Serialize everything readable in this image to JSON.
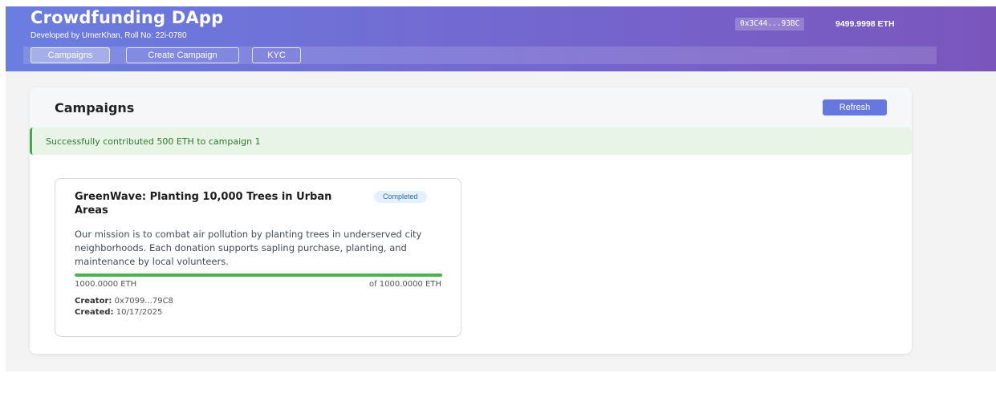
{
  "app": {
    "title": "Crowdfunding DApp",
    "subtitle": "Developed by UmerKhan, Roll No: 22i-0780"
  },
  "nav": {
    "items": [
      {
        "label": "Campaigns",
        "active": true
      },
      {
        "label": "Create Campaign",
        "active": false
      },
      {
        "label": "KYC",
        "active": false
      }
    ]
  },
  "wallet": {
    "address": "0x3C44...93BC",
    "balance": "9499.9998 ETH"
  },
  "panel": {
    "title": "Campaigns",
    "refresh_label": "Refresh"
  },
  "alert": {
    "message": "Successfully contributed 500 ETH to campaign 1"
  },
  "campaign": {
    "title": "GreenWave: Planting 10,000 Trees in Urban Areas",
    "status": "Completed",
    "description": "Our mission is to combat air pollution by planting trees in underserved city neighborhoods. Each donation supports sapling purchase, planting, and maintenance by local volunteers.",
    "raised": "1000.0000 ETH",
    "goal": "of 1000.0000 ETH",
    "progress_percent": 100,
    "creator_label": "Creator:",
    "creator": "0x7099...79C8",
    "created_label": "Created:",
    "created": "10/17/2025"
  },
  "colors": {
    "header_start": "#6a7ee0",
    "header_end": "#7a56bc",
    "accent": "#6677df",
    "success": "#4caf50"
  }
}
